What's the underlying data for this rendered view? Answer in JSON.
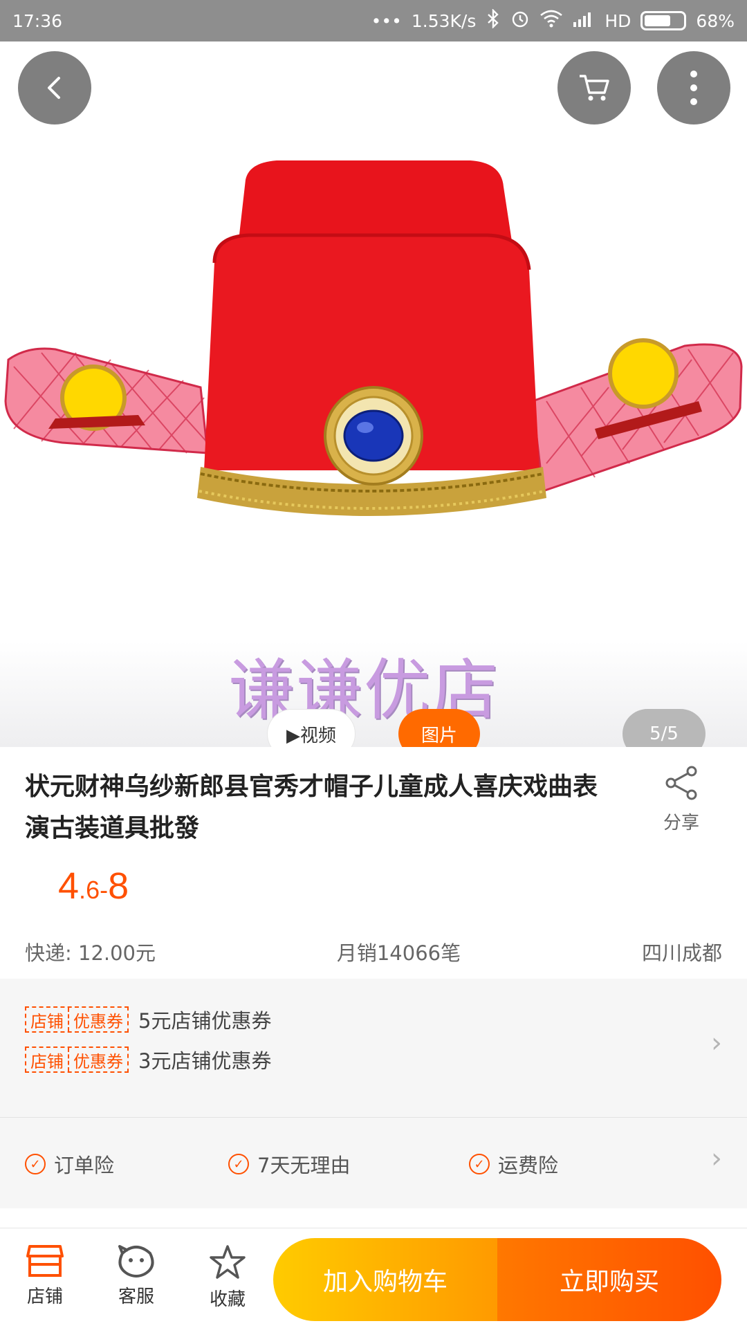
{
  "status_bar": {
    "time": "17:36",
    "network_speed": "1.53K/s",
    "hd_label": "HD",
    "battery_percent": "68%",
    "battery_level": 0.68
  },
  "gallery": {
    "watermark_text": "谦谦优店",
    "video_label": "▶视频",
    "photo_label": "图片",
    "pager": "5/5"
  },
  "product": {
    "title": "状元财神乌纱新郎县官秀才帽子儿童成人喜庆戏曲表演古装道具批發",
    "share_label": "分享",
    "price_main": "4",
    "price_dot": ".",
    "price_small": "6",
    "price_dash": "-",
    "price_max": "8",
    "shipping": "快递: 12.00元",
    "monthly_sales": "月销14066笔",
    "location": "四川成都"
  },
  "coupons": [
    {
      "tag_left": "店铺",
      "tag_right": "优惠券",
      "text": "5元店铺优惠券"
    },
    {
      "tag_left": "店铺",
      "tag_right": "优惠券",
      "text": "3元店铺优惠券"
    }
  ],
  "services": [
    {
      "label": "订单险"
    },
    {
      "label": "7天无理由"
    },
    {
      "label": "运费险"
    }
  ],
  "bottom_bar": {
    "shop_label": "店铺",
    "service_label": "客服",
    "favorite_label": "收藏",
    "add_to_cart": "加入购物车",
    "buy_now": "立即购买"
  },
  "colors": {
    "accent": "#ff5000",
    "cart_button": "#ffb300",
    "buy_button": "#ff5000",
    "hat_red": "#e8141c"
  }
}
